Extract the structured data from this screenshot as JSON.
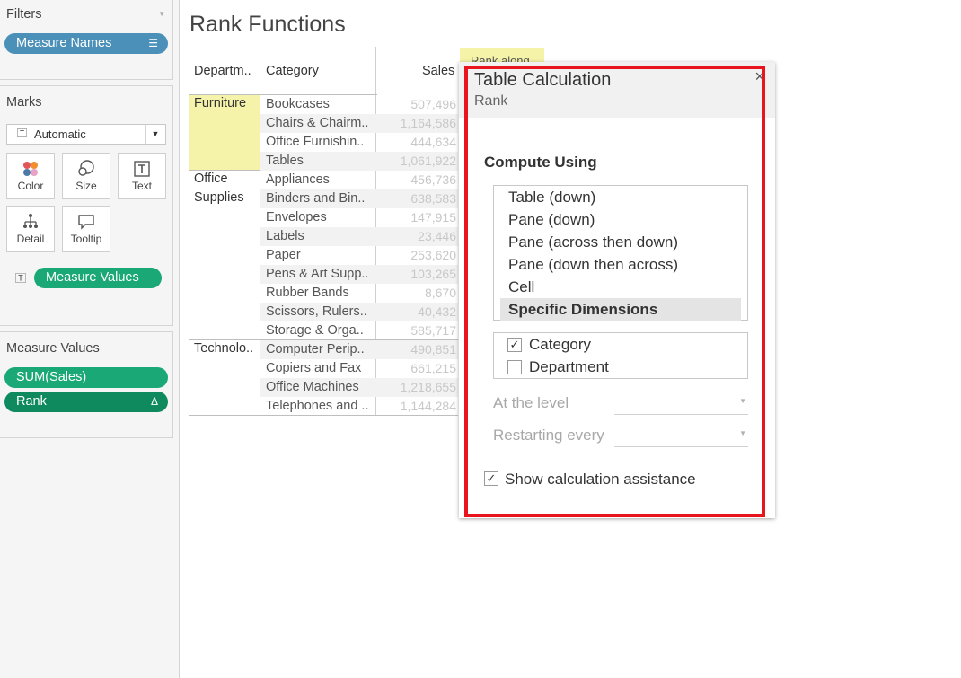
{
  "sidebar": {
    "filters": {
      "title": "Filters",
      "pill": "Measure Names"
    },
    "marks": {
      "title": "Marks",
      "mark_type": "Automatic",
      "buttons": {
        "color": "Color",
        "size": "Size",
        "text": "Text",
        "detail": "Detail",
        "tooltip": "Tooltip"
      },
      "text_pill": "Measure Values"
    },
    "measure_values": {
      "title": "Measure Values",
      "pills": [
        "SUM(Sales)",
        "Rank"
      ],
      "rank_icon": "Δ"
    }
  },
  "sheet": {
    "title": "Rank Functions",
    "headers": {
      "department": "Departm..",
      "category": "Category",
      "sales": "Sales",
      "rank_along": "Rank along"
    },
    "departments": [
      "Furniture",
      "Office",
      "Supplies",
      "Technolo.."
    ],
    "rows": [
      {
        "category": "Bookcases",
        "sales": "507,496"
      },
      {
        "category": "Chairs & Chairm..",
        "sales": "1,164,586"
      },
      {
        "category": "Office Furnishin..",
        "sales": "444,634"
      },
      {
        "category": "Tables",
        "sales": "1,061,922"
      },
      {
        "category": "Appliances",
        "sales": "456,736"
      },
      {
        "category": "Binders and Bin..",
        "sales": "638,583"
      },
      {
        "category": "Envelopes",
        "sales": "147,915"
      },
      {
        "category": "Labels",
        "sales": "23,446"
      },
      {
        "category": "Paper",
        "sales": "253,620"
      },
      {
        "category": "Pens & Art Supp..",
        "sales": "103,265"
      },
      {
        "category": "Rubber Bands",
        "sales": "8,670"
      },
      {
        "category": "Scissors, Rulers..",
        "sales": "40,432"
      },
      {
        "category": "Storage & Orga..",
        "sales": "585,717"
      },
      {
        "category": "Computer Perip..",
        "sales": "490,851"
      },
      {
        "category": "Copiers and Fax",
        "sales": "661,215"
      },
      {
        "category": "Office Machines",
        "sales": "1,218,655"
      },
      {
        "category": "Telephones and ..",
        "sales": "1,144,284"
      }
    ]
  },
  "dialog": {
    "title": "Table Calculation",
    "subtitle": "Rank",
    "close": "×",
    "compute_using_label": "Compute Using",
    "compute_options": [
      "Table (down)",
      "Pane (down)",
      "Pane (across then down)",
      "Pane (down then across)",
      "Cell",
      "Specific Dimensions"
    ],
    "selected_option": "Specific Dimensions",
    "dimensions": [
      {
        "label": "Category",
        "checked": true,
        "mark": "✓"
      },
      {
        "label": "Department",
        "checked": false,
        "mark": ""
      }
    ],
    "at_the_level_label": "At the level",
    "restarting_every_label": "Restarting every",
    "show_assistance_label": "Show calculation assistance",
    "show_assistance_mark": "✓"
  },
  "colors": {
    "highlight_frame": "#e8141e",
    "pill_blue": "#4a90b8",
    "pill_green": "#1aa876",
    "dept_band": "#f4f3a9"
  }
}
